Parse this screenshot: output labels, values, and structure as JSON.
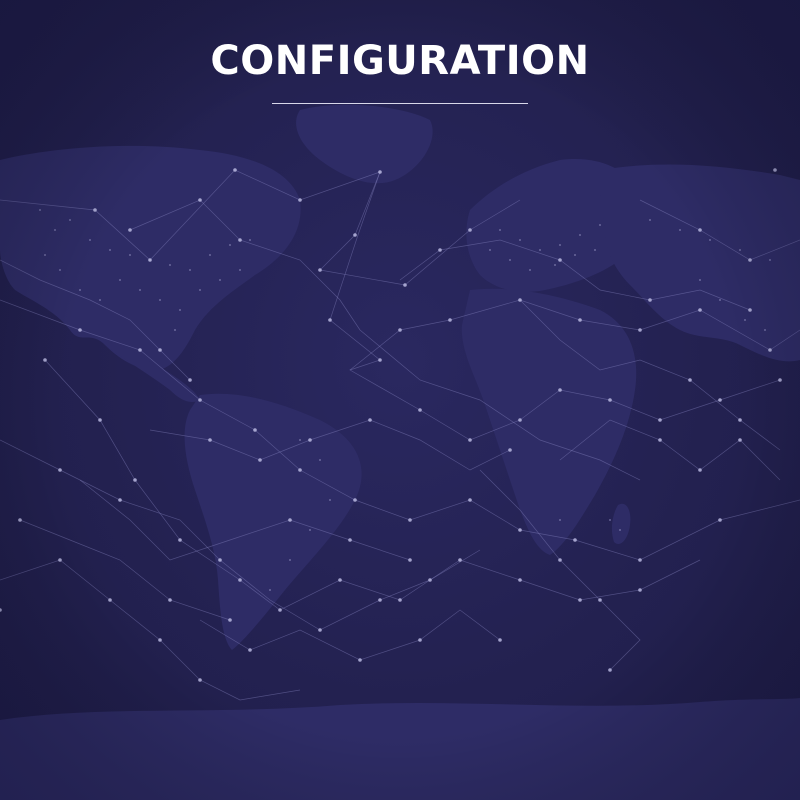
{
  "page": {
    "title": "CONFIGURATION"
  },
  "theme": {
    "background": "#232150",
    "landmass": "#2f2d68",
    "city_lights": "#9a98c8",
    "network_line": "#8886c0",
    "network_node": "#b9b8e0",
    "title_color": "#ffffff"
  },
  "decor": {
    "background_image": "world-network-map"
  }
}
